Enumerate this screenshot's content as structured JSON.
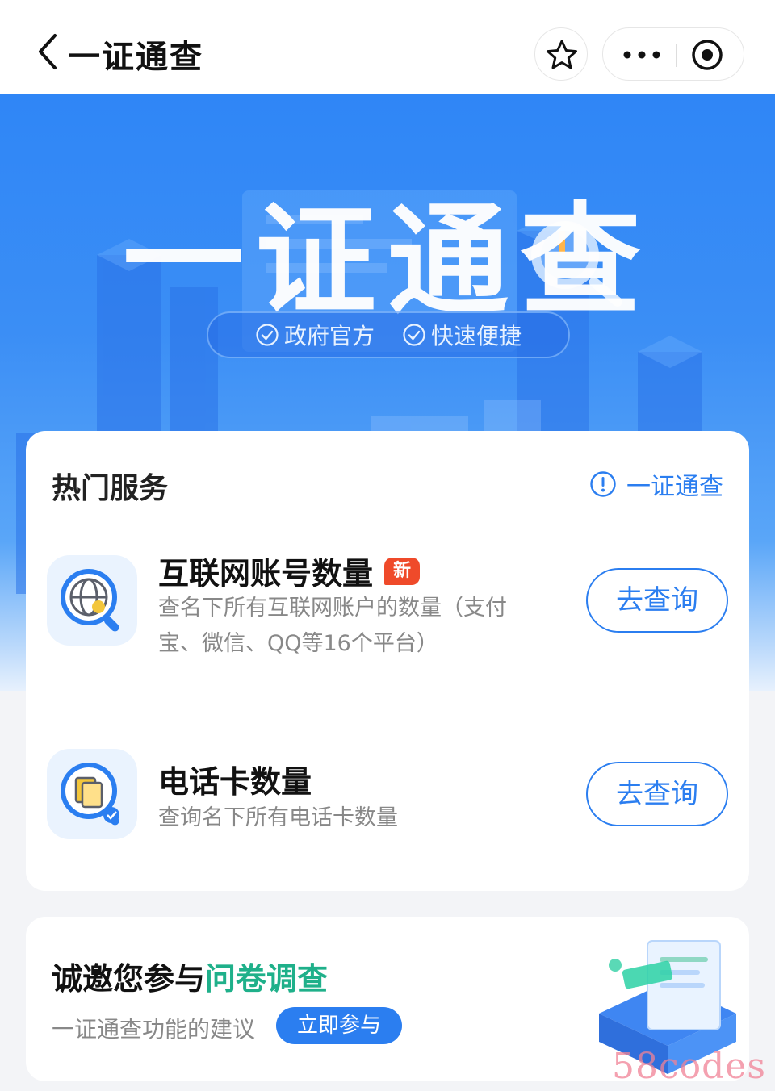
{
  "header": {
    "title": "一证通查"
  },
  "banner": {
    "title": "一证通查",
    "tags": [
      "政府官方",
      "快速便捷"
    ]
  },
  "services": {
    "title": "热门服务",
    "help_label": "一证通查",
    "items": [
      {
        "name": "互联网账号数量",
        "badge": "新",
        "description": "查名下所有互联网账户的数量（支付宝、微信、QQ等16个平台）",
        "button": "去查询",
        "icon": "globe-search-icon"
      },
      {
        "name": "电话卡数量",
        "description": "查询名下所有电话卡数量",
        "button": "去查询",
        "icon": "sim-card-search-icon"
      }
    ]
  },
  "survey": {
    "title_prefix": "诚邀您参与",
    "title_highlight": "问卷调查",
    "subtitle": "一证通查功能的建议",
    "button": "立即参与"
  },
  "watermark": "58codes",
  "colors": {
    "accent": "#2b7ef0",
    "badge": "#ef4a2a",
    "highlight": "#1fb08a"
  }
}
